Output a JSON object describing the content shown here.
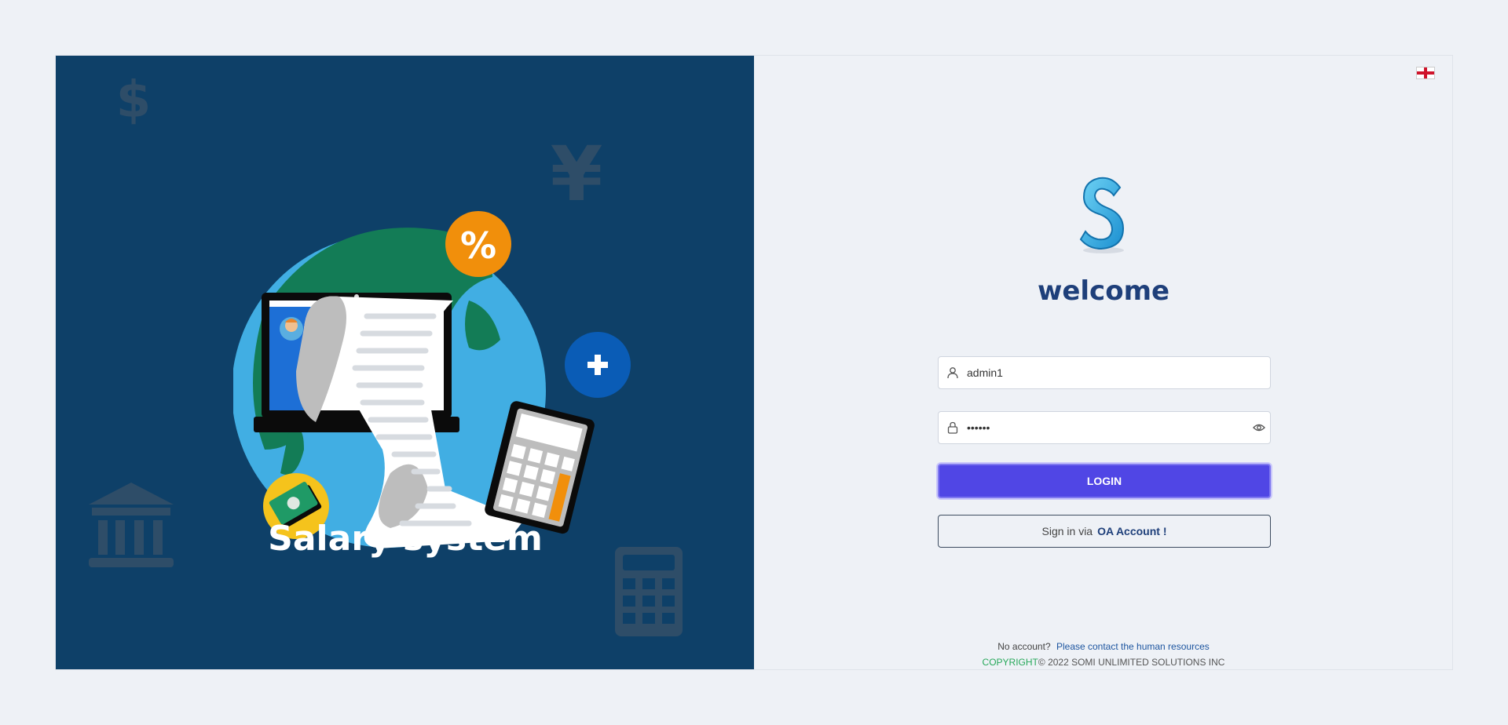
{
  "left_panel": {
    "title": "Salary system",
    "background_icons": [
      "dollar-icon",
      "yen-icon",
      "bank-icon",
      "calculator-icon"
    ]
  },
  "right_panel": {
    "language_flag": "england-flag-icon",
    "welcome": "welcome",
    "username": {
      "value": "admin1",
      "icon": "user-icon"
    },
    "password": {
      "value": "••••••",
      "icon": "lock-icon",
      "toggle_icon": "eye-icon"
    },
    "login_button": "LOGIN",
    "oa_signin": {
      "prefix": "Sign in via",
      "link": "OA Account !"
    },
    "footer": {
      "no_account": "No account?",
      "contact": "Please contact the human resources",
      "copyright_word": "COPYRIGHT",
      "copyright_rest": "© 2022 SOMI UNLIMITED SOLUTIONS INC"
    }
  },
  "colors": {
    "left_bg": "#0e4068",
    "login_button": "#5046e5",
    "title_blue": "#1e3f7a",
    "copyright_green": "#27a85a"
  }
}
